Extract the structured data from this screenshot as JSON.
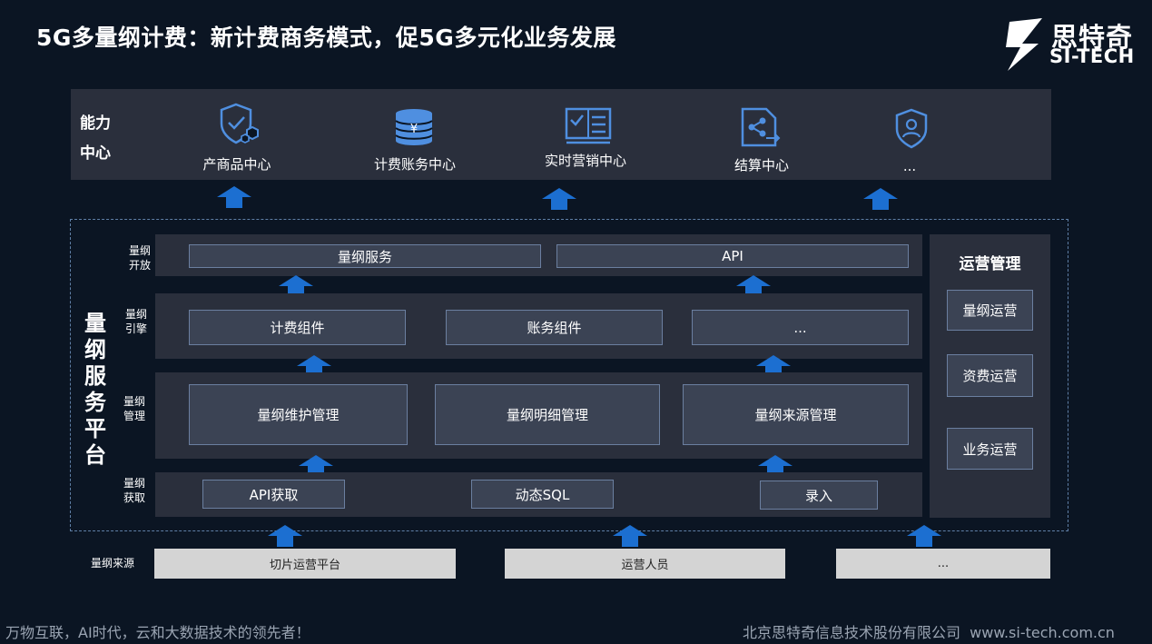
{
  "title": "5G多量纲计费：新计费商务模式，促5G多元化业务发展",
  "logo": {
    "cn": "思特奇",
    "en": "SI-TECH"
  },
  "capability": {
    "label_line1": "能力",
    "label_line2": "中心",
    "items": [
      "产商品中心",
      "计费账务中心",
      "实时营销中心",
      "结算中心",
      "..."
    ],
    "icons": [
      "shield-check-icon",
      "coin-stack-icon",
      "checklist-board-icon",
      "document-share-icon",
      "user-shield-icon"
    ]
  },
  "platform": {
    "label": "量纲服务平台",
    "open": {
      "label_line1": "量纲",
      "label_line2": "开放",
      "items": [
        "量纲服务",
        "API"
      ]
    },
    "engine": {
      "label_line1": "量纲",
      "label_line2": "引擎",
      "items": [
        "计费组件",
        "账务组件",
        "..."
      ]
    },
    "manage": {
      "label_line1": "量纲",
      "label_line2": "管理",
      "items": [
        "量纲维护管理",
        "量纲明细管理",
        "量纲来源管理"
      ]
    },
    "acquire": {
      "label_line1": "量纲",
      "label_line2": "获取",
      "items": [
        "API获取",
        "动态SQL",
        "录入"
      ]
    }
  },
  "operations": {
    "title": "运营管理",
    "items": [
      "量纲运营",
      "资费运营",
      "业务运营"
    ]
  },
  "source": {
    "label": "量纲来源",
    "items": [
      "切片运营平台",
      "运营人员",
      "..."
    ]
  },
  "footer": {
    "left": "万物互联，AI时代，云和大数据技术的领先者！",
    "right": "北京思特奇信息技术股份有限公司  www.si-tech.com.cn"
  },
  "colors": {
    "background": "#0b1523",
    "panel": "#2a2f3c",
    "box": "#3b4354",
    "icon": "#4f8fe0",
    "arrow": "#1c6fd1"
  }
}
